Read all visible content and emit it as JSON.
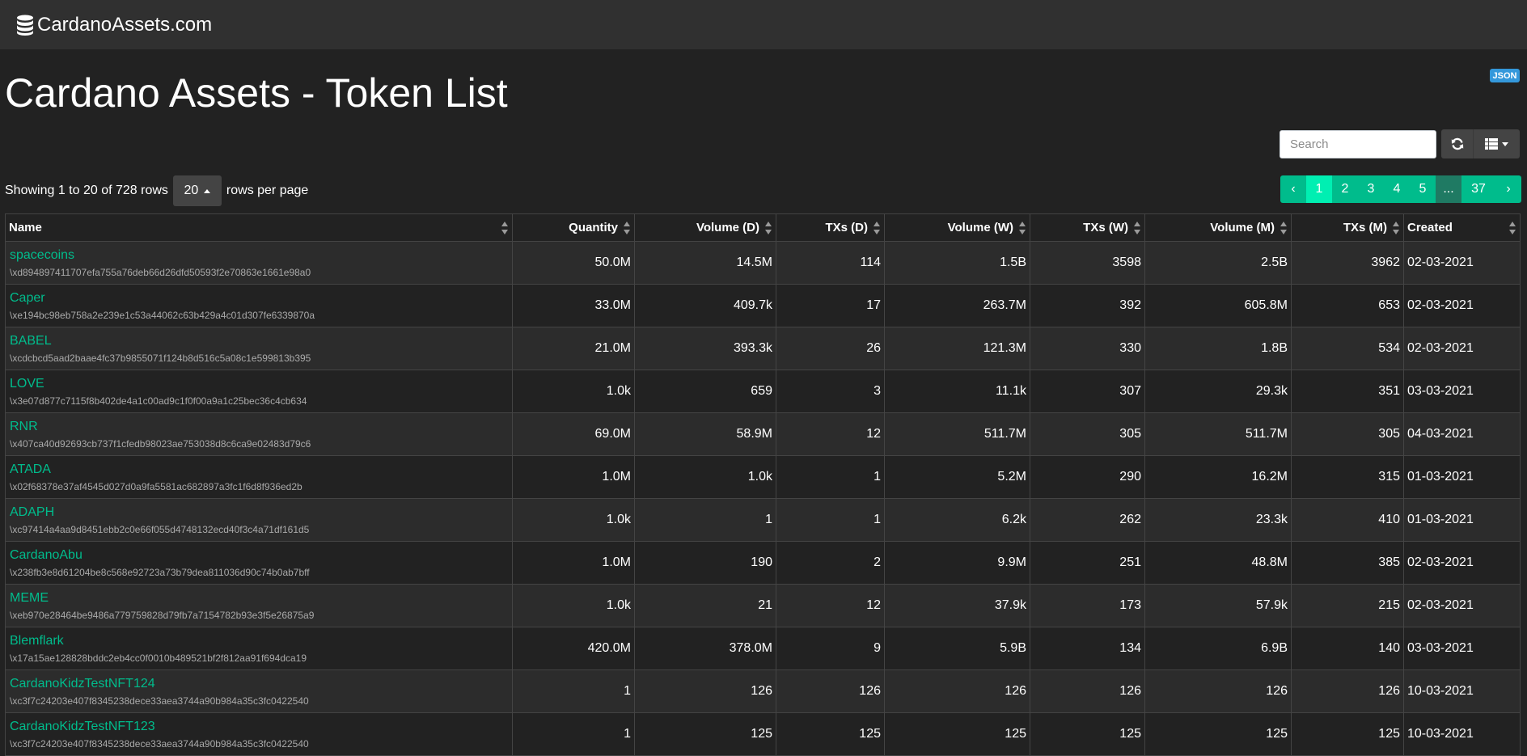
{
  "navbar": {
    "brand": "CardanoAssets.com",
    "brand_icon": "database-icon"
  },
  "page": {
    "title": "Cardano Assets - Token List",
    "json_badge": "JSON"
  },
  "toolbar": {
    "search_placeholder": "Search",
    "refresh_icon": "refresh-icon",
    "columns_icon": "columns-icon"
  },
  "pagination_info": {
    "showing": "Showing 1 to 20 of 728 rows",
    "page_size": "20",
    "rows_per_page": "rows per page"
  },
  "pagination": {
    "prev": "‹",
    "pages": [
      "1",
      "2",
      "3",
      "4",
      "5"
    ],
    "active": "1",
    "ellipsis": "...",
    "last": "37",
    "next": "›"
  },
  "colors": {
    "accent": "#00bc8c",
    "active_page": "#00efb2",
    "badge": "#3498db",
    "background": "#222222",
    "navbar": "#303030"
  },
  "table": {
    "headers": [
      "Name",
      "Quantity",
      "Volume (D)",
      "TXs (D)",
      "Volume (W)",
      "TXs (W)",
      "Volume (M)",
      "TXs (M)",
      "Created"
    ],
    "rows": [
      {
        "name": "spacecoins",
        "hash": "\\xd894897411707efa755a76deb66d26dfd50593f2e70863e1661e98a0",
        "quantity": "50.0M",
        "vol_d": "14.5M",
        "txs_d": "114",
        "vol_w": "1.5B",
        "txs_w": "3598",
        "vol_m": "2.5B",
        "txs_m": "3962",
        "created": "02-03-2021"
      },
      {
        "name": "Caper",
        "hash": "\\xe194bc98eb758a2e239e1c53a44062c63b429a4c01d307fe6339870a",
        "quantity": "33.0M",
        "vol_d": "409.7k",
        "txs_d": "17",
        "vol_w": "263.7M",
        "txs_w": "392",
        "vol_m": "605.8M",
        "txs_m": "653",
        "created": "02-03-2021"
      },
      {
        "name": "BABEL",
        "hash": "\\xcdcbcd5aad2baae4fc37b9855071f124b8d516c5a08c1e599813b395",
        "quantity": "21.0M",
        "vol_d": "393.3k",
        "txs_d": "26",
        "vol_w": "121.3M",
        "txs_w": "330",
        "vol_m": "1.8B",
        "txs_m": "534",
        "created": "02-03-2021"
      },
      {
        "name": "LOVE",
        "hash": "\\x3e07d877c7115f8b402de4a1c00ad9c1f0f00a9a1c25bec36c4cb634",
        "quantity": "1.0k",
        "vol_d": "659",
        "txs_d": "3",
        "vol_w": "11.1k",
        "txs_w": "307",
        "vol_m": "29.3k",
        "txs_m": "351",
        "created": "03-03-2021"
      },
      {
        "name": "RNR",
        "hash": "\\x407ca40d92693cb737f1cfedb98023ae753038d8c6ca9e02483d79c6",
        "quantity": "69.0M",
        "vol_d": "58.9M",
        "txs_d": "12",
        "vol_w": "511.7M",
        "txs_w": "305",
        "vol_m": "511.7M",
        "txs_m": "305",
        "created": "04-03-2021"
      },
      {
        "name": "ATADA",
        "hash": "\\x02f68378e37af4545d027d0a9fa5581ac682897a3fc1f6d8f936ed2b",
        "quantity": "1.0M",
        "vol_d": "1.0k",
        "txs_d": "1",
        "vol_w": "5.2M",
        "txs_w": "290",
        "vol_m": "16.2M",
        "txs_m": "315",
        "created": "01-03-2021"
      },
      {
        "name": "ADAPH",
        "hash": "\\xc97414a4aa9d8451ebb2c0e66f055d4748132ecd40f3c4a71df161d5",
        "quantity": "1.0k",
        "vol_d": "1",
        "txs_d": "1",
        "vol_w": "6.2k",
        "txs_w": "262",
        "vol_m": "23.3k",
        "txs_m": "410",
        "created": "01-03-2021"
      },
      {
        "name": "CardanoAbu",
        "hash": "\\x238fb3e8d61204be8c568e92723a73b79dea811036d90c74b0ab7bff",
        "quantity": "1.0M",
        "vol_d": "190",
        "txs_d": "2",
        "vol_w": "9.9M",
        "txs_w": "251",
        "vol_m": "48.8M",
        "txs_m": "385",
        "created": "02-03-2021"
      },
      {
        "name": "MEME",
        "hash": "\\xeb970e28464be9486a779759828d79fb7a7154782b93e3f5e26875a9",
        "quantity": "1.0k",
        "vol_d": "21",
        "txs_d": "12",
        "vol_w": "37.9k",
        "txs_w": "173",
        "vol_m": "57.9k",
        "txs_m": "215",
        "created": "02-03-2021"
      },
      {
        "name": "Blemflark",
        "hash": "\\x17a15ae128828bddc2eb4cc0f0010b489521bf2f812aa91f694dca19",
        "quantity": "420.0M",
        "vol_d": "378.0M",
        "txs_d": "9",
        "vol_w": "5.9B",
        "txs_w": "134",
        "vol_m": "6.9B",
        "txs_m": "140",
        "created": "03-03-2021"
      },
      {
        "name": "CardanoKidzTestNFT124",
        "hash": "\\xc3f7c24203e407f8345238dece33aea3744a90b984a35c3fc0422540",
        "quantity": "1",
        "vol_d": "126",
        "txs_d": "126",
        "vol_w": "126",
        "txs_w": "126",
        "vol_m": "126",
        "txs_m": "126",
        "created": "10-03-2021"
      },
      {
        "name": "CardanoKidzTestNFT123",
        "hash": "\\xc3f7c24203e407f8345238dece33aea3744a90b984a35c3fc0422540",
        "quantity": "1",
        "vol_d": "125",
        "txs_d": "125",
        "vol_w": "125",
        "txs_w": "125",
        "vol_m": "125",
        "txs_m": "125",
        "created": "10-03-2021"
      }
    ]
  }
}
